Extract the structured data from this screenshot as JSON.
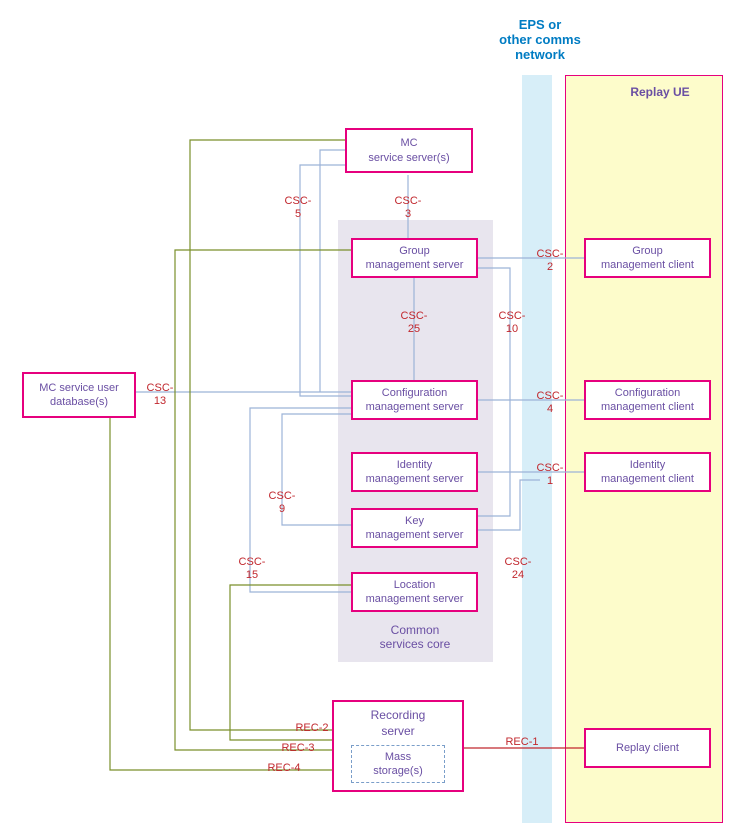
{
  "headers": {
    "eps": "EPS or\nother comms\nnetwork",
    "replay_ue": "Replay UE",
    "common_services_core": "Common\nservices core",
    "recording_server": "Recording\nserver"
  },
  "nodes": {
    "mc_server": "MC\nservice server(s)",
    "group_server": "Group\nmanagement server",
    "configuration_server": "Configuration\nmanagement server",
    "identity_server": "Identity\nmanagement server",
    "key_server": "Key\nmanagement server",
    "location_server": "Location\nmanagement server",
    "group_client": "Group\nmanagement client",
    "configuration_client": "Configuration\nmanagement client",
    "identity_client": "Identity\nmanagement client",
    "replay_client": "Replay client",
    "user_db": "MC service user\ndatabase(s)",
    "mass_storage": "Mass\nstorage(s)"
  },
  "labels": {
    "csc5": "CSC-\n5",
    "csc3": "CSC-\n3",
    "csc2": "CSC-\n2",
    "csc25": "CSC-\n25",
    "csc10": "CSC-\n10",
    "csc13": "CSC-\n13",
    "csc4": "CSC-\n4",
    "csc1": "CSC-\n1",
    "csc9": "CSC-\n9",
    "csc15": "CSC-\n15",
    "csc24": "CSC-\n24",
    "rec1": "REC-1",
    "rec2": "REC-2",
    "rec3": "REC-3",
    "rec4": "REC-4"
  },
  "colors": {
    "accent_pink": "#e6007e",
    "text_purple": "#6a4fa3",
    "label_red": "#c1272d",
    "header_blue": "#007cc3",
    "line_blue": "#9cb3d8",
    "line_olive": "#7a8f2b",
    "line_red": "#c1272d",
    "zone_blue": "#d7eef8",
    "zone_yellow": "#fdfccb",
    "zone_grey": "#e8e5ee"
  }
}
